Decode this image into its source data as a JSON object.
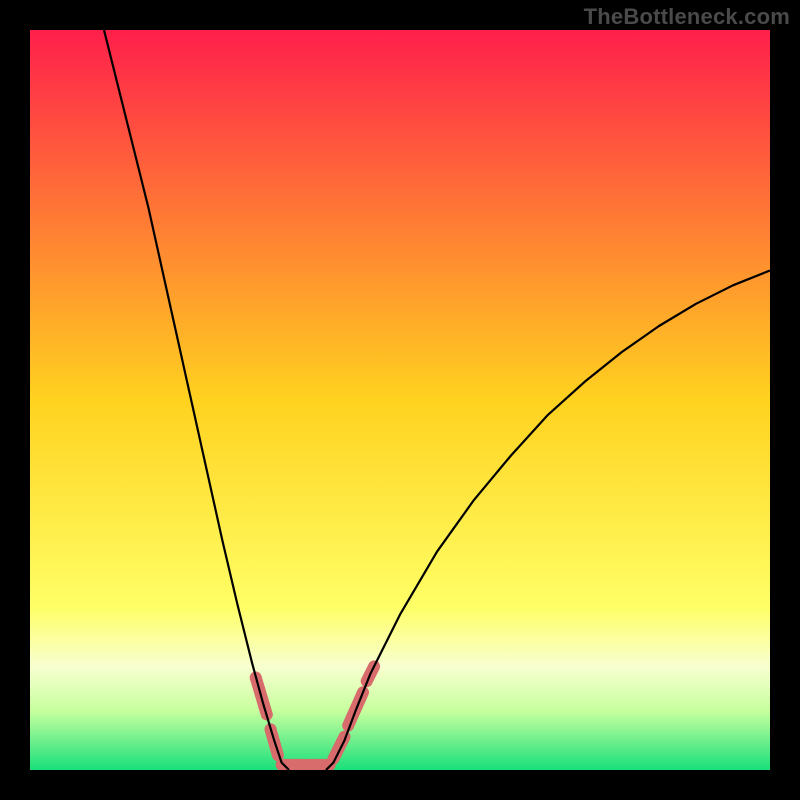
{
  "watermark": "TheBottleneck.com",
  "chart_data": {
    "type": "line",
    "title": "",
    "xlabel": "",
    "ylabel": "",
    "xlim": [
      0,
      100
    ],
    "ylim": [
      0,
      100
    ],
    "background_gradient": {
      "stops": [
        {
          "offset": 0.0,
          "color": "#ff1f4b"
        },
        {
          "offset": 0.5,
          "color": "#ffd21f"
        },
        {
          "offset": 0.78,
          "color": "#ffff66"
        },
        {
          "offset": 0.86,
          "color": "#f8ffd0"
        },
        {
          "offset": 0.92,
          "color": "#c7ff9e"
        },
        {
          "offset": 1.0,
          "color": "#18e07a"
        }
      ]
    },
    "series": [
      {
        "name": "bottleneck-curve-left",
        "stroke": "#000000",
        "stroke_width": 2.2,
        "points": [
          {
            "x": 10.0,
            "y": 100.0
          },
          {
            "x": 12.0,
            "y": 92.0
          },
          {
            "x": 14.0,
            "y": 84.0
          },
          {
            "x": 16.0,
            "y": 76.0
          },
          {
            "x": 18.0,
            "y": 67.0
          },
          {
            "x": 20.0,
            "y": 58.0
          },
          {
            "x": 22.0,
            "y": 49.0
          },
          {
            "x": 24.0,
            "y": 40.0
          },
          {
            "x": 26.0,
            "y": 31.0
          },
          {
            "x": 28.0,
            "y": 22.5
          },
          {
            "x": 30.0,
            "y": 14.5
          },
          {
            "x": 31.5,
            "y": 9.0
          },
          {
            "x": 33.0,
            "y": 4.0
          },
          {
            "x": 34.0,
            "y": 1.0
          },
          {
            "x": 35.0,
            "y": 0.0
          }
        ]
      },
      {
        "name": "bottleneck-curve-right",
        "stroke": "#000000",
        "stroke_width": 2.2,
        "points": [
          {
            "x": 40.0,
            "y": 0.0
          },
          {
            "x": 41.0,
            "y": 1.0
          },
          {
            "x": 42.5,
            "y": 4.0
          },
          {
            "x": 44.0,
            "y": 8.0
          },
          {
            "x": 46.0,
            "y": 13.0
          },
          {
            "x": 50.0,
            "y": 21.0
          },
          {
            "x": 55.0,
            "y": 29.5
          },
          {
            "x": 60.0,
            "y": 36.5
          },
          {
            "x": 65.0,
            "y": 42.5
          },
          {
            "x": 70.0,
            "y": 48.0
          },
          {
            "x": 75.0,
            "y": 52.5
          },
          {
            "x": 80.0,
            "y": 56.5
          },
          {
            "x": 85.0,
            "y": 60.0
          },
          {
            "x": 90.0,
            "y": 63.0
          },
          {
            "x": 95.0,
            "y": 65.5
          },
          {
            "x": 100.0,
            "y": 67.5
          }
        ]
      },
      {
        "name": "optimum-band-markers",
        "stroke": "#d86b6b",
        "stroke_width": 12,
        "linecap": "round",
        "segments": [
          {
            "x1": 30.5,
            "y1": 12.5,
            "x2": 32.0,
            "y2": 7.5
          },
          {
            "x1": 32.5,
            "y1": 5.5,
            "x2": 33.5,
            "y2": 2.0
          },
          {
            "x1": 34.0,
            "y1": 0.7,
            "x2": 37.0,
            "y2": 0.7
          },
          {
            "x1": 37.5,
            "y1": 0.7,
            "x2": 40.5,
            "y2": 0.7
          },
          {
            "x1": 41.0,
            "y1": 1.5,
            "x2": 42.5,
            "y2": 4.5
          },
          {
            "x1": 43.0,
            "y1": 6.0,
            "x2": 45.0,
            "y2": 10.5
          },
          {
            "x1": 45.5,
            "y1": 12.0,
            "x2": 46.5,
            "y2": 14.0
          }
        ]
      }
    ]
  }
}
